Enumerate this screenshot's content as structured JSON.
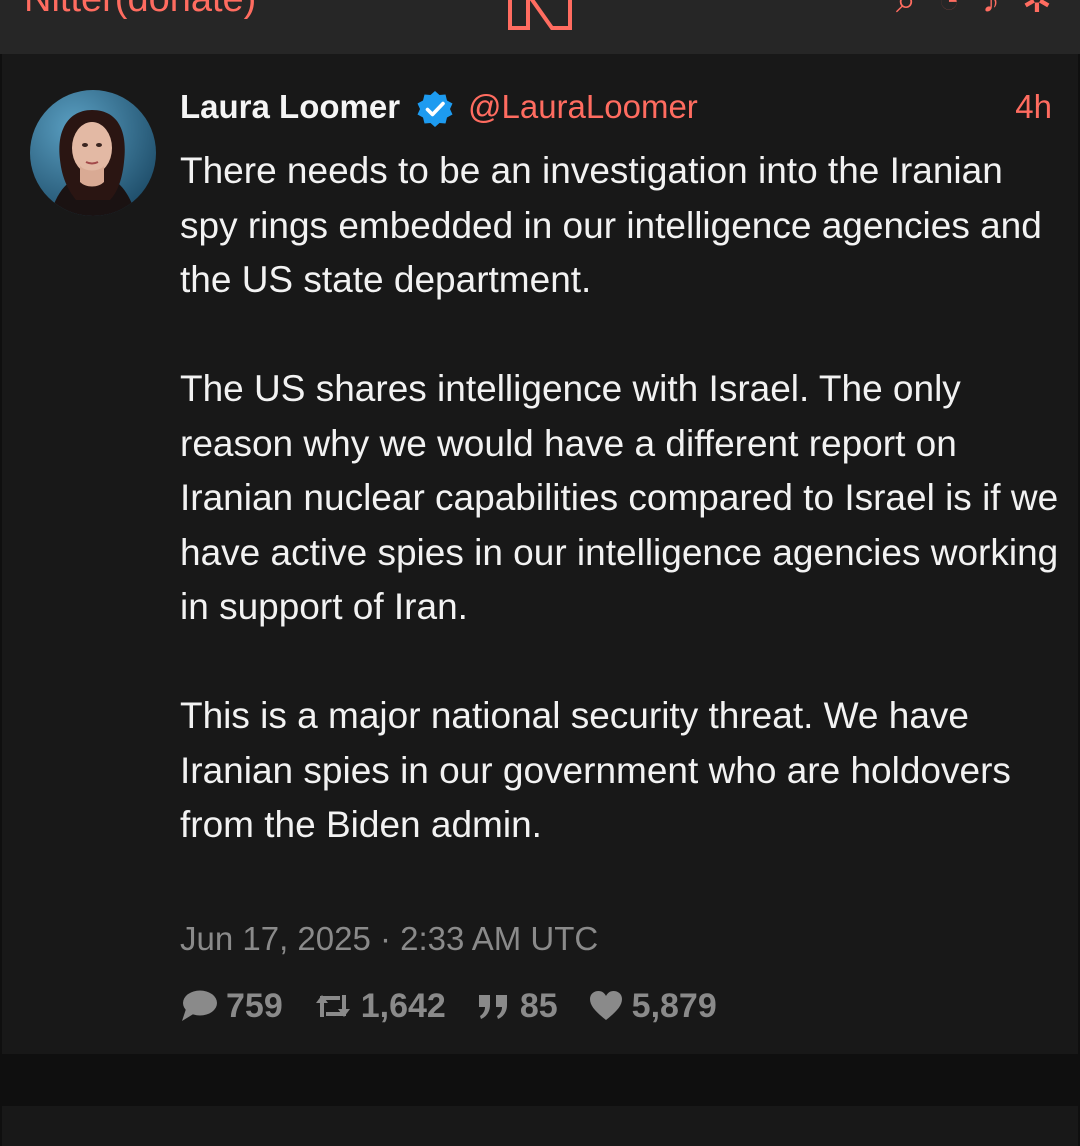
{
  "topbar": {
    "site_link": "Nitter(donate)",
    "logo_icon": "nitter-logo-icon",
    "icons": [
      "search-icon",
      "rss-icon",
      "pin-icon",
      "settings-icon"
    ],
    "accent_color": "#ff6c60"
  },
  "tweet": {
    "fullname": "Laura Loomer",
    "verified_icon": "verified-badge-icon",
    "username": "@LauraLoomer",
    "age": "4h",
    "paragraphs": [
      "There needs to be an investigation into the Iranian spy rings embedded in our intelligence agencies and the US state department.",
      "The US shares intelligence with Israel. The only reason why we would have a different report on Iranian nuclear capabilities compared to Israel is if we have active spies in our intelligence agencies working in support of Iran.",
      "This is a major national security threat. We have Iranian spies in our government who are holdovers from the Biden admin."
    ],
    "published": "Jun 17, 2025 · 2:33 AM UTC",
    "stats": {
      "replies": "759",
      "retweets": "1,642",
      "quotes": "85",
      "likes": "5,879"
    }
  }
}
